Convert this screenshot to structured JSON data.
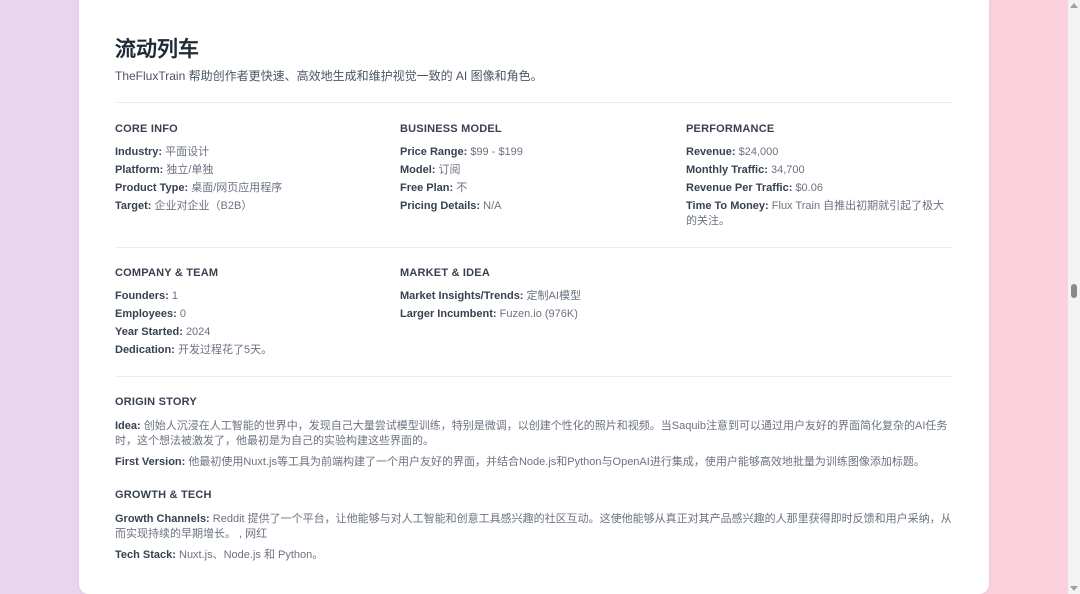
{
  "title": "流动列车",
  "subtitle": "TheFluxTrain 帮助创作者更快速、高效地生成和维护视觉一致的 AI 图像和角色。",
  "core_info": {
    "heading": "CORE INFO",
    "rows": [
      {
        "label": "Industry:",
        "value": "平面设计"
      },
      {
        "label": "Platform:",
        "value": "独立/单独"
      },
      {
        "label": "Product Type:",
        "value": "桌面/网页应用程序"
      },
      {
        "label": "Target:",
        "value": "企业对企业（B2B）"
      }
    ]
  },
  "business_model": {
    "heading": "BUSINESS MODEL",
    "rows": [
      {
        "label": "Price Range:",
        "value": "$99 - $199"
      },
      {
        "label": "Model:",
        "value": "订阅"
      },
      {
        "label": "Free Plan:",
        "value": "不"
      },
      {
        "label": "Pricing Details:",
        "value": "N/A"
      }
    ]
  },
  "performance": {
    "heading": "PERFORMANCE",
    "rows": [
      {
        "label": "Revenue:",
        "value": "$24,000"
      },
      {
        "label": "Monthly Traffic:",
        "value": "34,700"
      },
      {
        "label": "Revenue Per Traffic:",
        "value": "$0.06"
      },
      {
        "label": "Time To Money:",
        "value": "Flux Train 自推出初期就引起了极大的关注。"
      }
    ]
  },
  "company_team": {
    "heading": "COMPANY & TEAM",
    "rows": [
      {
        "label": "Founders:",
        "value": "1"
      },
      {
        "label": "Employees:",
        "value": "0"
      },
      {
        "label": "Year Started:",
        "value": "2024"
      },
      {
        "label": "Dedication:",
        "value": "开发过程花了5天。"
      }
    ]
  },
  "market_idea": {
    "heading": "MARKET & IDEA",
    "rows": [
      {
        "label": "Market Insights/Trends:",
        "value": "定制AI模型"
      },
      {
        "label": "Larger Incumbent:",
        "value": "Fuzen.io (976K)"
      }
    ]
  },
  "origin_story": {
    "heading": "ORIGIN STORY",
    "rows": [
      {
        "label": "Idea:",
        "value": "创始人沉浸在人工智能的世界中，发现自己大量尝试模型训练，特别是微调，以创建个性化的照片和视频。当Saquib注意到可以通过用户友好的界面简化复杂的AI任务时，这个想法被激发了，他最初是为自己的实验构建这些界面的。"
      },
      {
        "label": "First Version:",
        "value": "他最初使用Nuxt.js等工具为前端构建了一个用户友好的界面，并结合Node.js和Python与OpenAI进行集成，使用户能够高效地批量为训练图像添加标题。"
      }
    ]
  },
  "growth_tech": {
    "heading": "GROWTH & TECH",
    "rows": [
      {
        "label": "Growth Channels:",
        "value": "Reddit 提供了一个平台，让他能够与对人工智能和创意工具感兴趣的社区互动。这使他能够从真正对其产品感兴趣的人那里获得即时反馈和用户采纳，从而实现持续的早期增长。 , 网红"
      },
      {
        "label": "Tech Stack:",
        "value": "Nuxt.js、Node.js 和 Python。"
      }
    ]
  }
}
